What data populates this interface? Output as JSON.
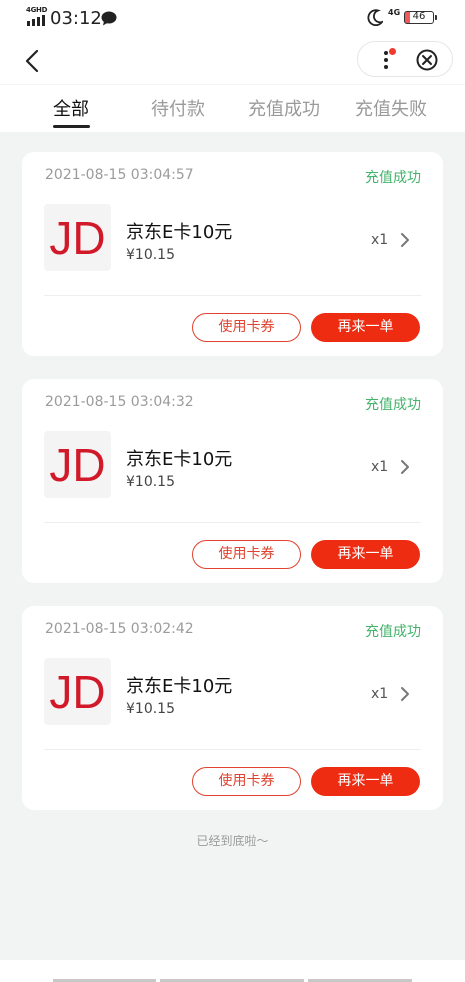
{
  "status_bar": {
    "network_tag": "4GHD",
    "time": "03:12",
    "network_right": "4G",
    "battery": "46"
  },
  "nav": {
    "back_icon": "chevron-left-icon",
    "more_icon": "more-vertical-icon",
    "close_icon": "circle-x-icon"
  },
  "tabs": [
    {
      "label": "全部",
      "active": true
    },
    {
      "label": "待付款",
      "active": false
    },
    {
      "label": "充值成功",
      "active": false
    },
    {
      "label": "充值失败",
      "active": false
    }
  ],
  "orders": [
    {
      "time": "2021-08-15 03:04:57",
      "status": "充值成功",
      "logo_text": "JD",
      "product": "京东E卡10元",
      "price": "¥10.15",
      "qty": "x1",
      "use_label": "使用卡券",
      "reorder_label": "再来一单"
    },
    {
      "time": "2021-08-15 03:04:32",
      "status": "充值成功",
      "logo_text": "JD",
      "product": "京东E卡10元",
      "price": "¥10.15",
      "qty": "x1",
      "use_label": "使用卡券",
      "reorder_label": "再来一单"
    },
    {
      "time": "2021-08-15 03:02:42",
      "status": "充值成功",
      "logo_text": "JD",
      "product": "京东E卡10元",
      "price": "¥10.15",
      "qty": "x1",
      "use_label": "使用卡券",
      "reorder_label": "再来一单"
    }
  ],
  "footer": "已经到底啦～",
  "colors": {
    "accent": "#ee2c12",
    "success": "#43b36b",
    "jd_red": "#d1192a"
  }
}
